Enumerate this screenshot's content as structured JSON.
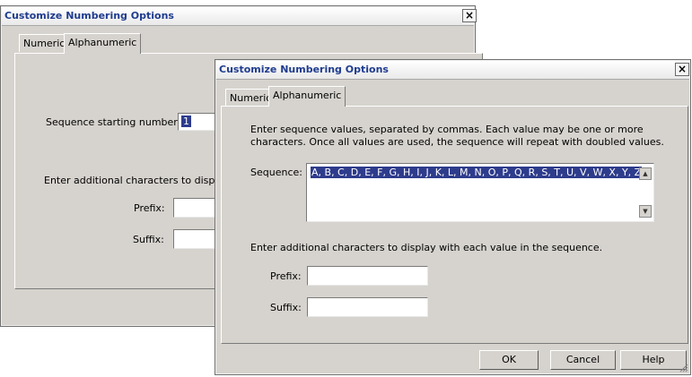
{
  "back_dialog": {
    "title": "Customize Numbering Options",
    "close": "×",
    "tabs": [
      "Numeric",
      "Alphanumeric"
    ],
    "start_label": "Sequence starting number:",
    "start_value": "1",
    "additional_text": "Enter additional characters to display w",
    "prefix_label": "Prefix:",
    "suffix_label": "Suffix:"
  },
  "front_dialog": {
    "title": "Customize Numbering Options",
    "close": "×",
    "tabs": [
      "Numeric",
      "Alphanumeric"
    ],
    "instructions_line1": "Enter sequence values, separated by commas.  Each value may be one or more",
    "instructions_line2": "characters.  Once all values are used, the sequence will repeat with doubled values.",
    "sequence_label": "Sequence:",
    "sequence_value": "A, B, C, D, E, F, G, H, I, J, K, L, M, N, O, P, Q, R, S, T, U, V, W, X, Y, Z",
    "additional_text": "Enter additional characters to display with each value in the sequence.",
    "prefix_label": "Prefix:",
    "prefix_value": "",
    "suffix_label": "Suffix:",
    "suffix_value": "",
    "buttons": {
      "ok": "OK",
      "cancel": "Cancel",
      "help": "Help"
    }
  },
  "icons": {
    "scroll_up": "▲",
    "scroll_down": "▼"
  }
}
